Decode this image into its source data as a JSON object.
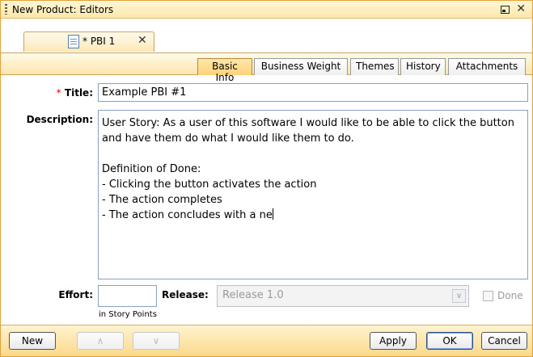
{
  "window": {
    "title": "New Product: Editors"
  },
  "document_tab": {
    "label": "* PBI 1"
  },
  "subtabs": [
    {
      "label": "Basic Info",
      "active": true
    },
    {
      "label": "Business Weight",
      "active": false
    },
    {
      "label": "Themes",
      "active": false
    },
    {
      "label": "History",
      "active": false
    },
    {
      "label": "Attachments",
      "active": false
    }
  ],
  "form": {
    "title_required_mark": "*",
    "title_label": "Title:",
    "title_value": "Example PBI #1",
    "description_label": "Description:",
    "description_value": "User Story: As a user of this software I would like to be able to click the button\nand have them do what I would like them to do.\n\nDefinition of Done:\n- Clicking the button activates the action\n- The action completes\n- The action concludes with a ne",
    "effort_label": "Effort:",
    "effort_value": "",
    "effort_unit": "in Story Points",
    "release_label": "Release:",
    "release_value": "Release 1.0",
    "done_label": "Done",
    "done_checked": false
  },
  "buttons": {
    "new": "New",
    "up": "∧",
    "down": "∨",
    "apply": "Apply",
    "ok": "OK",
    "cancel": "Cancel"
  },
  "icons": {
    "grip": "drag-grip-icon",
    "restore": "restore-window-icon",
    "close": "close-icon",
    "document": "document-icon",
    "dropdown": "chevron-down-icon"
  },
  "colors": {
    "accent_border": "#e0a23a",
    "active_tab": "#fcd27a",
    "required_mark": "#dd0000"
  }
}
